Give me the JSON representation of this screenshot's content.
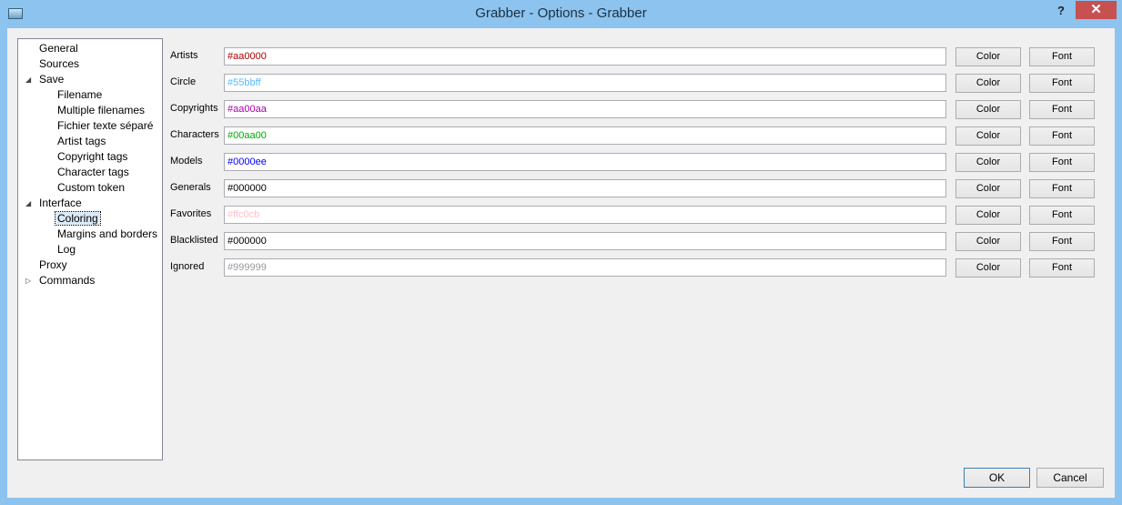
{
  "window": {
    "title": "Grabber - Options - Grabber",
    "help_label": "?",
    "close_label": "✕"
  },
  "tree": {
    "items": [
      {
        "label": "General"
      },
      {
        "label": "Sources"
      },
      {
        "label": "Save"
      },
      {
        "label": "Filename"
      },
      {
        "label": "Multiple filenames"
      },
      {
        "label": "Fichier texte séparé"
      },
      {
        "label": "Artist tags"
      },
      {
        "label": "Copyright tags"
      },
      {
        "label": "Character tags"
      },
      {
        "label": "Custom token"
      },
      {
        "label": "Interface"
      },
      {
        "label": "Coloring",
        "selected": true
      },
      {
        "label": "Margins and borders"
      },
      {
        "label": "Log"
      },
      {
        "label": "Proxy"
      },
      {
        "label": "Commands"
      }
    ]
  },
  "coloring": {
    "color_button_label": "Color",
    "font_button_label": "Font",
    "rows": [
      {
        "label": "Artists",
        "value": "#aa0000",
        "color": "#aa0000"
      },
      {
        "label": "Circle",
        "value": "#55bbff",
        "color": "#55bbff"
      },
      {
        "label": "Copyrights",
        "value": "#aa00aa",
        "color": "#aa00aa"
      },
      {
        "label": "Characters",
        "value": "#00aa00",
        "color": "#00aa00"
      },
      {
        "label": "Models",
        "value": "#0000ee",
        "color": "#0000ee"
      },
      {
        "label": "Generals",
        "value": "#000000",
        "color": "#000000"
      },
      {
        "label": "Favorites",
        "value": "#ffc0cb",
        "color": "#ffc0cb"
      },
      {
        "label": "Blacklisted",
        "value": "#000000",
        "color": "#000000"
      },
      {
        "label": "Ignored",
        "value": "#999999",
        "color": "#999999"
      }
    ]
  },
  "footer": {
    "ok_label": "OK",
    "cancel_label": "Cancel"
  }
}
